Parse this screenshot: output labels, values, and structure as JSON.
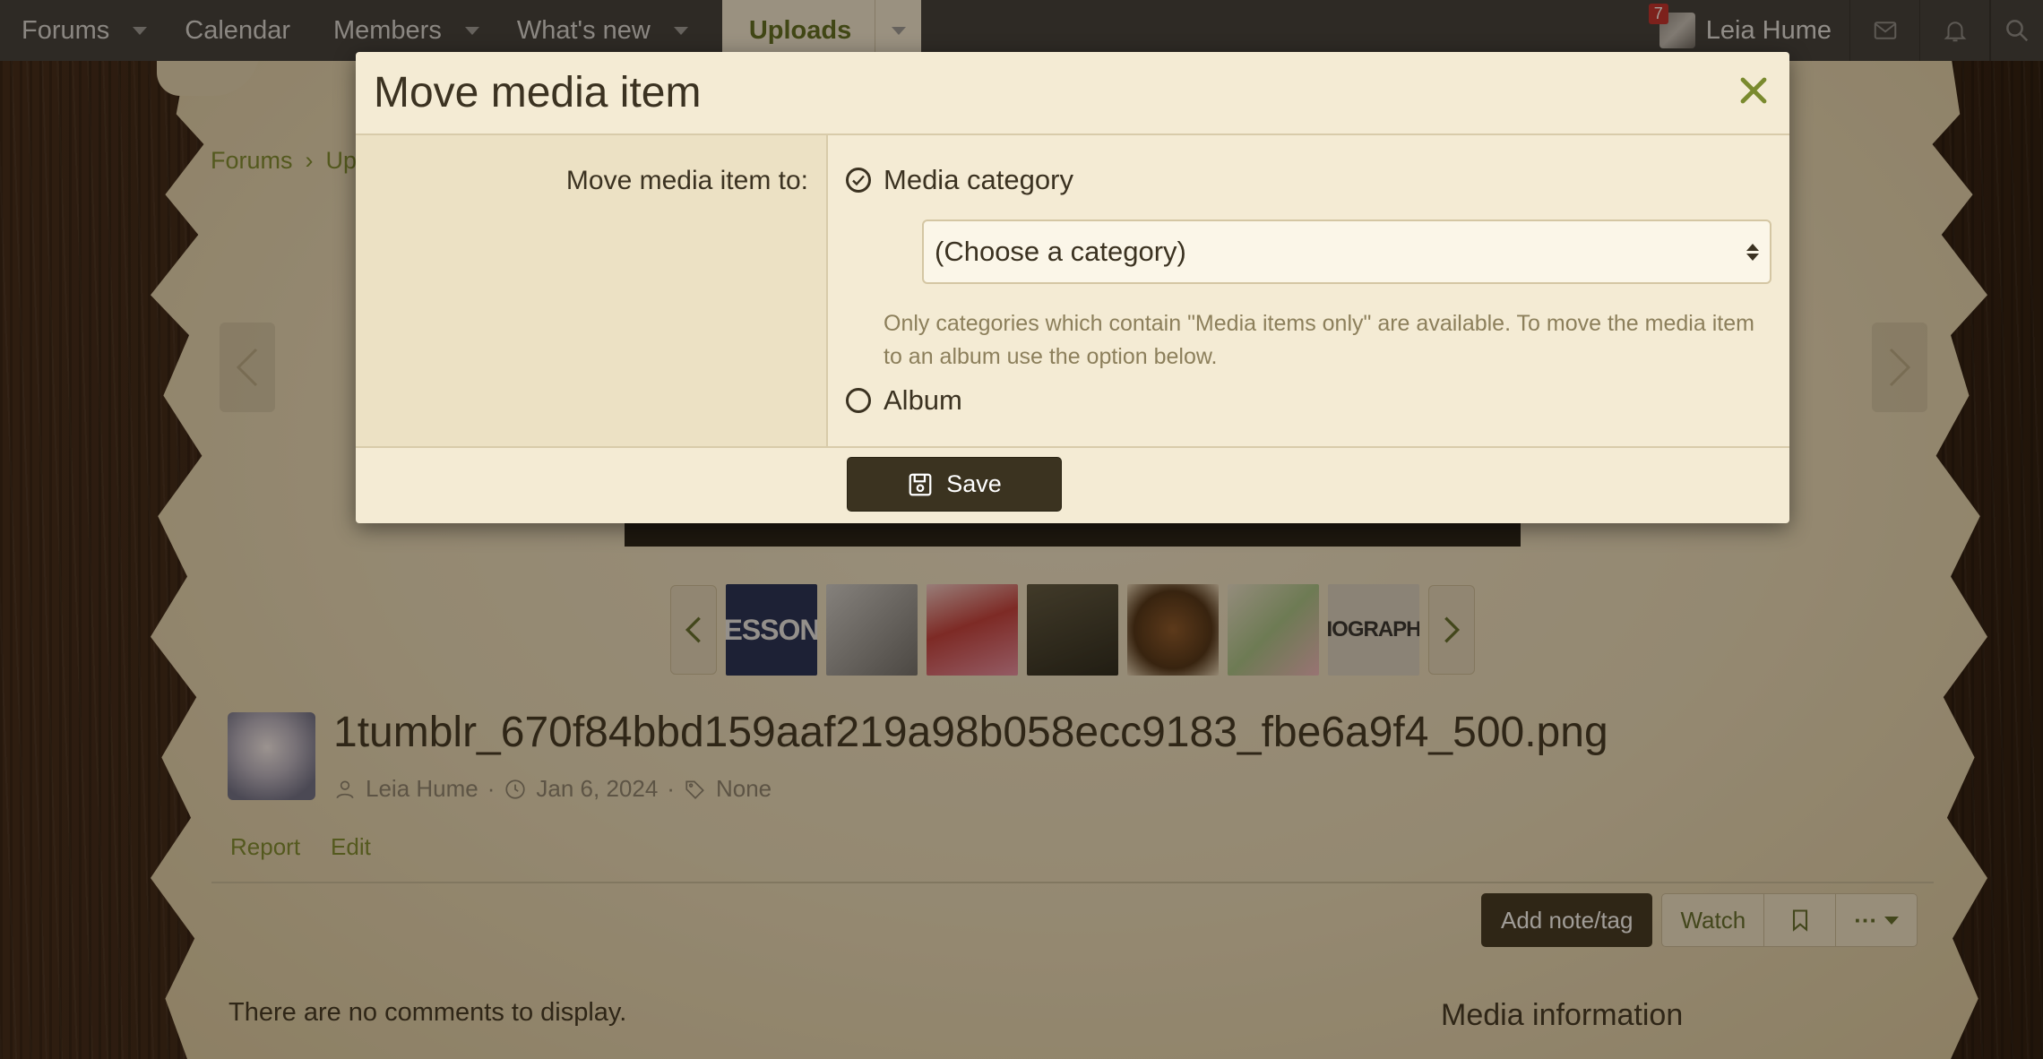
{
  "nav": {
    "items": [
      {
        "label": "Forums",
        "has_caret": true
      },
      {
        "label": "Calendar",
        "has_caret": false
      },
      {
        "label": "Members",
        "has_caret": true
      },
      {
        "label": "What's new",
        "has_caret": true
      }
    ],
    "active": {
      "label": "Uploads",
      "has_caret": true
    },
    "user": {
      "name": "Leia Hume",
      "alerts_badge": "7"
    }
  },
  "breadcrumb": {
    "items": [
      "Forums",
      "Up"
    ],
    "separator": "›"
  },
  "thumbnails": [
    {
      "text": "ESSON",
      "bg": "#1c2a55",
      "fg": "#e8e8e8"
    },
    {
      "text": "",
      "bg": "#8c8c8c",
      "fg": "#fff"
    },
    {
      "text": "",
      "bg": "#c34a4a",
      "fg": "#fff"
    },
    {
      "text": "",
      "bg": "#3a3a2c",
      "fg": "#fff"
    },
    {
      "text": "",
      "bg": "#5c3a1e",
      "fg": "#fff"
    },
    {
      "text": "",
      "bg": "#c9d8b2",
      "fg": "#fff"
    },
    {
      "text": "IOGRAPH",
      "bg": "#d9d2c4",
      "fg": "#2e2e2e"
    }
  ],
  "media": {
    "title": "1tumblr_670f84bbd159aaf219a98b058ecc9183_fbe6a9f4_500.png",
    "author": "Leia Hume",
    "date": "Jan 6, 2024",
    "tags": "None",
    "actions": [
      "Report",
      "Edit"
    ]
  },
  "buttons": {
    "add_note": "Add note/tag",
    "watch": "Watch",
    "more": "···"
  },
  "comments_empty": "There are no comments to display.",
  "sidebar_heading": "Media information",
  "modal": {
    "title": "Move media item",
    "label": "Move media item to:",
    "option_category": "Media category",
    "select_value": "(Choose a category)",
    "hint": "Only categories which contain \"Media items only\" are available. To move the media item to an album use the option below.",
    "option_album": "Album",
    "save_label": "Save"
  },
  "colors": {
    "accent": "#7a8a2e",
    "dark_button": "#3b3320",
    "nav_bg": "#3a3a3a",
    "modal_bg": "#f4ebd4"
  }
}
